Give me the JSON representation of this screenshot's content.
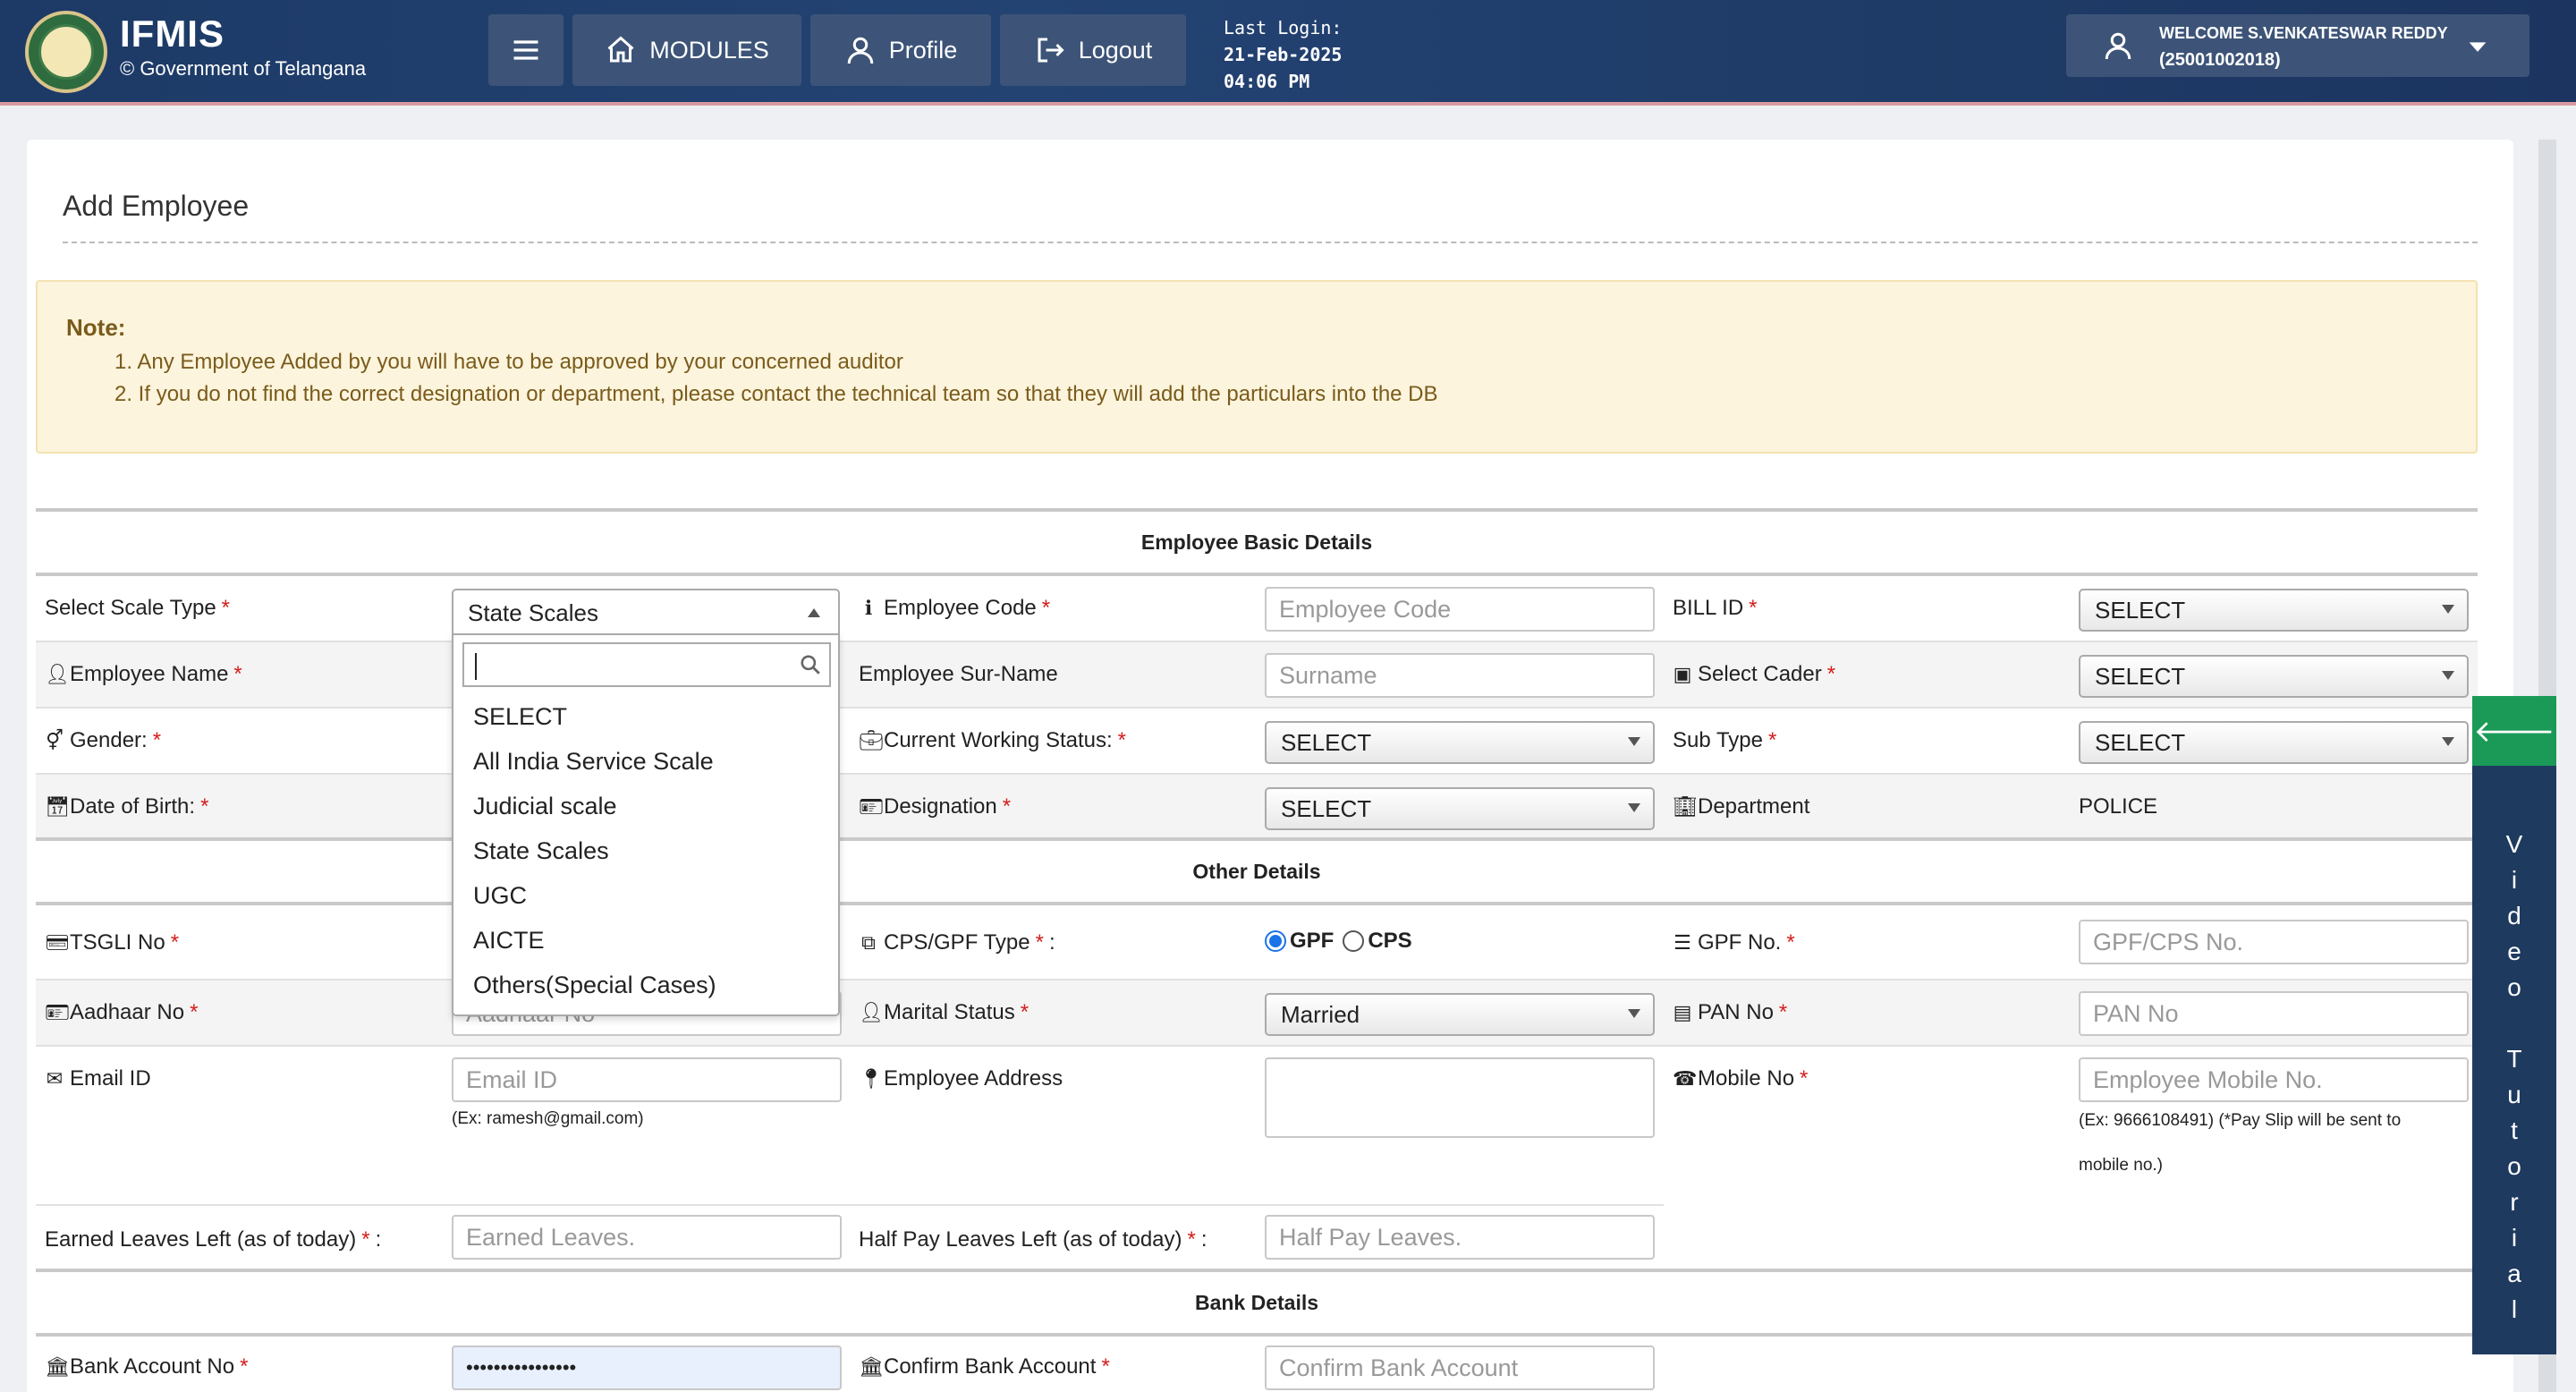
{
  "header": {
    "app_name": "IFMIS",
    "org": "© Government of Telangana",
    "modules": "MODULES",
    "profile": "Profile",
    "logout": "Logout",
    "last_login_label": "Last Login:",
    "last_login_date": "21-Feb-2025",
    "last_login_time": "04:06 PM",
    "welcome": "WELCOME S.VENKATESWAR REDDY",
    "user_id": "(25001002018)"
  },
  "page": {
    "title": "Add Employee"
  },
  "note": {
    "heading": "Note:",
    "line1": "1. Any Employee Added by you will have to be approved by your concerned auditor",
    "line2": "2. If you do not find the correct designation or department, please contact the technical team so that they will add the particulars into the DB"
  },
  "sections": {
    "basic": "Employee Basic Details",
    "other": "Other Details",
    "bank": "Bank Details"
  },
  "fields": {
    "scale_type": "Select Scale Type",
    "scale_value": "State Scales",
    "emp_code": "Employee Code",
    "emp_code_ph": "Employee Code",
    "bill_id": "BILL ID",
    "bill_id_val": "SELECT",
    "emp_name": "Employee Name",
    "surname": "Employee Sur-Name",
    "surname_ph": "Surname",
    "cader": "Select Cader",
    "cader_val": "SELECT",
    "gender": "Gender:",
    "work_status": "Current Working Status:",
    "work_status_val": "SELECT",
    "sub_type": "Sub Type",
    "sub_type_val": "SELECT",
    "dob": "Date of Birth:",
    "designation": "Designation",
    "designation_val": "SELECT",
    "department": "Department",
    "department_val": "POLICE",
    "tsgli": "TSGLI No",
    "cps_gpf": "CPS/GPF Type",
    "cps_gpf_colon": ":",
    "gpf": "GPF",
    "cps": "CPS",
    "gpf_no": "GPF No.",
    "gpf_no_ph": "GPF/CPS No.",
    "aadhaar": "Aadhaar No",
    "aadhaar_ph": "Aadhaar No",
    "marital": "Marital Status",
    "marital_val": "Married",
    "pan": "PAN No",
    "pan_ph": "PAN No",
    "email": "Email ID",
    "email_ph": "Email ID",
    "email_help": "(Ex: ramesh@gmail.com)",
    "address": "Employee Address",
    "mobile": "Mobile No",
    "mobile_ph": "Employee Mobile No.",
    "mobile_help1": "(Ex: 9666108491) (*Pay Slip will be sent to",
    "mobile_help2": "mobile no.)",
    "earned": "Earned Leaves Left (as of today)",
    "earned_ph": "Earned Leaves.",
    "colon": ":",
    "halfpay": "Half Pay Leaves Left (as of today)",
    "halfpay_ph": "Half Pay Leaves.",
    "bank_acc": "Bank Account No",
    "bank_acc_val": "••••••••••••••••",
    "confirm_bank": "Confirm Bank Account",
    "confirm_bank_ph": "Confirm Bank Account"
  },
  "dropdown": {
    "options": [
      "SELECT",
      "All India Service Scale",
      "Judicial scale",
      "State Scales",
      "UGC",
      "AICTE",
      "Others(Special Cases)"
    ]
  },
  "video_tutorial": {
    "label": "Video Tutorial"
  }
}
